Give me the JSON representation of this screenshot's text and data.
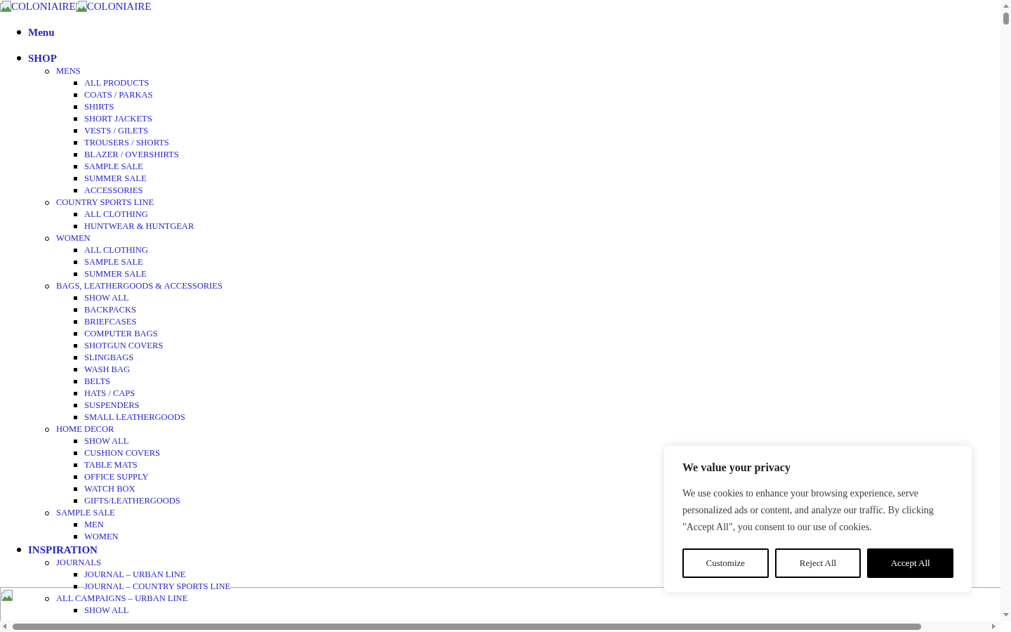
{
  "logo": [
    {
      "alt": "COLONIAIRE"
    },
    {
      "alt": "COLONIAIRE"
    }
  ],
  "nav": [
    {
      "label": "Menu"
    },
    {
      "label": "SHOP",
      "children": [
        {
          "label": "MENS",
          "children": [
            {
              "label": "ALL PRODUCTS"
            },
            {
              "label": "COATS / PARKAS"
            },
            {
              "label": "SHIRTS"
            },
            {
              "label": "SHORT JACKETS"
            },
            {
              "label": "VESTS / GILETS"
            },
            {
              "label": "TROUSERS / SHORTS"
            },
            {
              "label": "BLAZER / OVERSHIRTS"
            },
            {
              "label": "SAMPLE SALE"
            },
            {
              "label": "SUMMER SALE"
            },
            {
              "label": "ACCESSORIES"
            }
          ]
        },
        {
          "label": "COUNTRY SPORTS LINE",
          "children": [
            {
              "label": "ALL CLOTHING"
            },
            {
              "label": "HUNTWEAR & HUNTGEAR"
            }
          ]
        },
        {
          "label": "WOMEN",
          "children": [
            {
              "label": "ALL CLOTHING"
            },
            {
              "label": "SAMPLE SALE"
            },
            {
              "label": "SUMMER SALE"
            }
          ]
        },
        {
          "label": "BAGS, LEATHERGOODS & ACCESSORIES",
          "children": [
            {
              "label": "SHOW ALL"
            },
            {
              "label": "BACKPACKS"
            },
            {
              "label": "BRIEFCASES"
            },
            {
              "label": "COMPUTER BAGS"
            },
            {
              "label": "SHOTGUN COVERS"
            },
            {
              "label": "SLINGBAGS"
            },
            {
              "label": "WASH BAG"
            },
            {
              "label": "BELTS"
            },
            {
              "label": "HATS / CAPS"
            },
            {
              "label": "SUSPENDERS"
            },
            {
              "label": "SMALL LEATHERGOODS"
            }
          ]
        },
        {
          "label": "HOME DECOR",
          "children": [
            {
              "label": "SHOW ALL"
            },
            {
              "label": "CUSHION COVERS"
            },
            {
              "label": "TABLE MATS"
            },
            {
              "label": "OFFICE SUPPLY"
            },
            {
              "label": "WATCH BOX"
            },
            {
              "label": "GIFTS/LEATHERGOODS"
            }
          ]
        },
        {
          "label": "SAMPLE SALE",
          "children": [
            {
              "label": "MEN"
            },
            {
              "label": "WOMEN"
            }
          ]
        }
      ]
    },
    {
      "label": "INSPIRATION",
      "children": [
        {
          "label": "JOURNALS",
          "children": [
            {
              "label": "JOURNAL – URBAN LINE"
            },
            {
              "label": "JOURNAL – COUNTRY SPORTS LINE"
            }
          ]
        },
        {
          "label": "ALL CAMPAIGNS – URBAN LINE",
          "children": [
            {
              "label": "SHOW ALL"
            }
          ]
        }
      ]
    }
  ],
  "cookie_banner": {
    "title": "We value your privacy",
    "text": "We use cookies to enhance your browsing experience, serve personalized ads or content, and analyze our traffic. By clicking \"Accept All\", you consent to our use of cookies.",
    "buttons": [
      {
        "label": "Customize",
        "kind": "outline"
      },
      {
        "label": "Reject All",
        "kind": "outline"
      },
      {
        "label": "Accept All",
        "kind": "filled"
      }
    ]
  }
}
